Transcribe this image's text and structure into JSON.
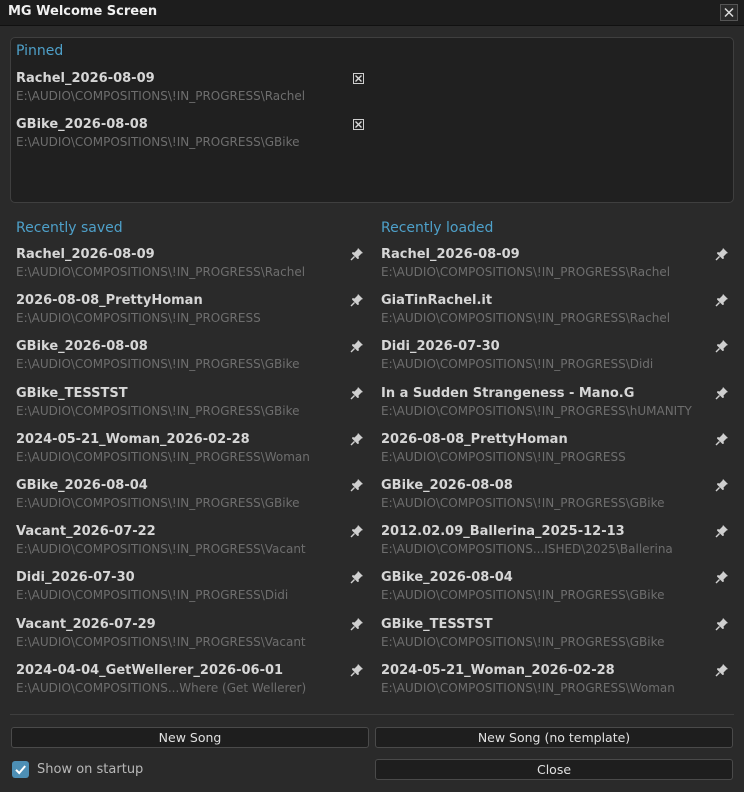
{
  "window": {
    "title": "MG Welcome Screen"
  },
  "pinned": {
    "title": "Pinned",
    "items": [
      {
        "name": "Rachel_2026-08-09",
        "path": "E:\\AUDIO\\COMPOSITIONS\\!IN_PROGRESS\\Rachel"
      },
      {
        "name": "GBike_2026-08-08",
        "path": "E:\\AUDIO\\COMPOSITIONS\\!IN_PROGRESS\\GBike"
      }
    ]
  },
  "recently_saved": {
    "title": "Recently saved",
    "items": [
      {
        "name": "Rachel_2026-08-09",
        "path": "E:\\AUDIO\\COMPOSITIONS\\!IN_PROGRESS\\Rachel"
      },
      {
        "name": "2026-08-08_PrettyHoman",
        "path": "E:\\AUDIO\\COMPOSITIONS\\!IN_PROGRESS"
      },
      {
        "name": "GBike_2026-08-08",
        "path": "E:\\AUDIO\\COMPOSITIONS\\!IN_PROGRESS\\GBike"
      },
      {
        "name": "GBike_TESSTST",
        "path": "E:\\AUDIO\\COMPOSITIONS\\!IN_PROGRESS\\GBike"
      },
      {
        "name": "2024-05-21_Woman_2026-02-28",
        "path": "E:\\AUDIO\\COMPOSITIONS\\!IN_PROGRESS\\Woman"
      },
      {
        "name": "GBike_2026-08-04",
        "path": "E:\\AUDIO\\COMPOSITIONS\\!IN_PROGRESS\\GBike"
      },
      {
        "name": "Vacant_2026-07-22",
        "path": "E:\\AUDIO\\COMPOSITIONS\\!IN_PROGRESS\\Vacant"
      },
      {
        "name": "Didi_2026-07-30",
        "path": "E:\\AUDIO\\COMPOSITIONS\\!IN_PROGRESS\\Didi"
      },
      {
        "name": "Vacant_2026-07-29",
        "path": "E:\\AUDIO\\COMPOSITIONS\\!IN_PROGRESS\\Vacant"
      },
      {
        "name": "2024-04-04_GetWellerer_2026-06-01",
        "path": "E:\\AUDIO\\COMPOSITIONS...Where (Get Wellerer)"
      }
    ]
  },
  "recently_loaded": {
    "title": "Recently loaded",
    "items": [
      {
        "name": "Rachel_2026-08-09",
        "path": "E:\\AUDIO\\COMPOSITIONS\\!IN_PROGRESS\\Rachel"
      },
      {
        "name": "GiaTinRachel.it",
        "path": "E:\\AUDIO\\COMPOSITIONS\\!IN_PROGRESS\\Rachel"
      },
      {
        "name": "Didi_2026-07-30",
        "path": "E:\\AUDIO\\COMPOSITIONS\\!IN_PROGRESS\\Didi"
      },
      {
        "name": "In a Sudden Strangeness - Mano.G",
        "path": "E:\\AUDIO\\COMPOSITIONS\\!IN_PROGRESS\\hUMANITY"
      },
      {
        "name": "2026-08-08_PrettyHoman",
        "path": "E:\\AUDIO\\COMPOSITIONS\\!IN_PROGRESS"
      },
      {
        "name": "GBike_2026-08-08",
        "path": "E:\\AUDIO\\COMPOSITIONS\\!IN_PROGRESS\\GBike"
      },
      {
        "name": "2012.02.09_Ballerina_2025-12-13",
        "path": "E:\\AUDIO\\COMPOSITIONS...ISHED\\2025\\Ballerina"
      },
      {
        "name": "GBike_2026-08-04",
        "path": "E:\\AUDIO\\COMPOSITIONS\\!IN_PROGRESS\\GBike"
      },
      {
        "name": "GBike_TESSTST",
        "path": "E:\\AUDIO\\COMPOSITIONS\\!IN_PROGRESS\\GBike"
      },
      {
        "name": "2024-05-21_Woman_2026-02-28",
        "path": "E:\\AUDIO\\COMPOSITIONS\\!IN_PROGRESS\\Woman"
      }
    ]
  },
  "footer": {
    "new_song": "New Song",
    "new_song_no_template": "New Song (no template)",
    "show_on_startup": "Show on startup",
    "show_on_startup_checked": true,
    "close": "Close"
  },
  "colors": {
    "accent": "#4ea0c9",
    "background": "#2a2a2a"
  }
}
